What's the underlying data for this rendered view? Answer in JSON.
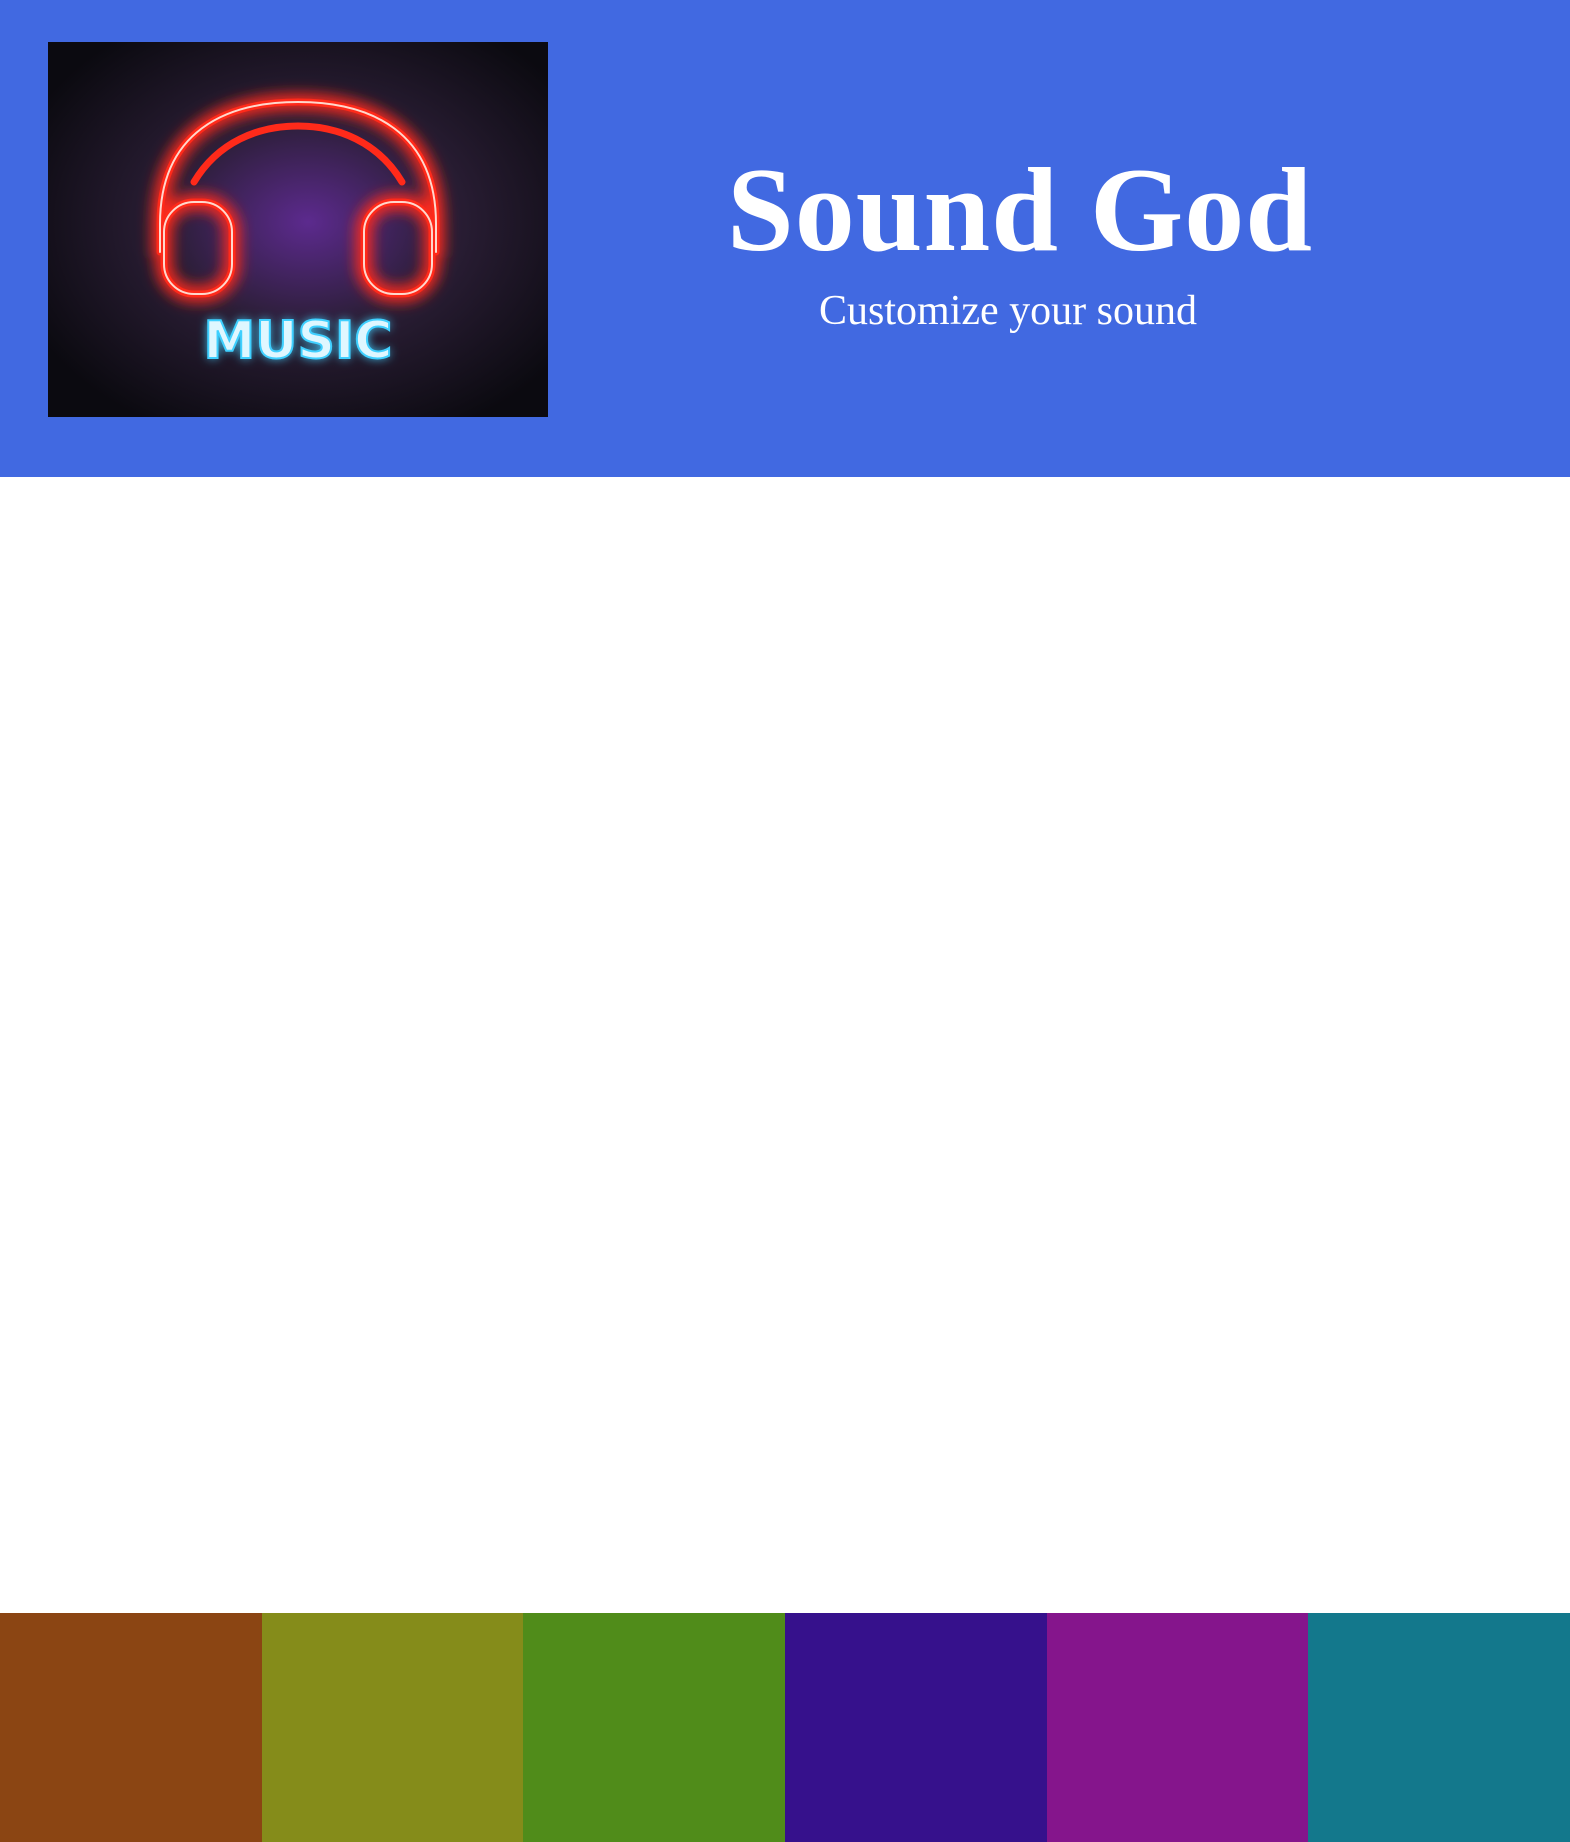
{
  "header": {
    "background": "#4169e1",
    "title": "Sound God",
    "subtitle": "Customize your sound",
    "logo": {
      "icon": "neon-headphones-icon",
      "text": "MUSIC",
      "headphone_color": "#ff2a1a",
      "text_color": "#3fd0ff"
    }
  },
  "swatches": [
    {
      "name": "brown",
      "color": "#8b4513"
    },
    {
      "name": "olive",
      "color": "#858c1a"
    },
    {
      "name": "green",
      "color": "#508c1a"
    },
    {
      "name": "indigo",
      "color": "#36118c"
    },
    {
      "name": "purple",
      "color": "#85158c"
    },
    {
      "name": "teal",
      "color": "#13788c"
    }
  ]
}
